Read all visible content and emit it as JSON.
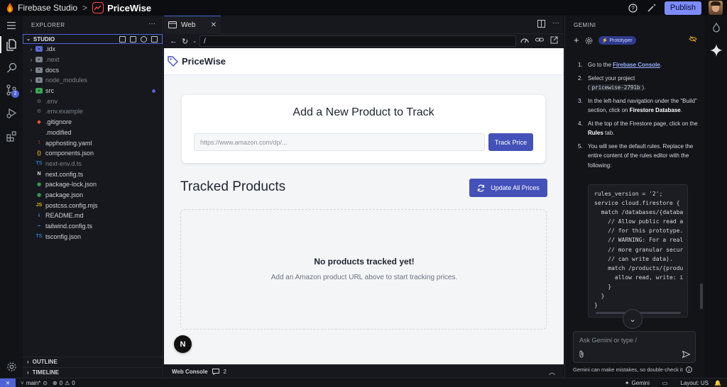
{
  "topbar": {
    "app_name": "Firebase Studio",
    "separator": ">",
    "project_name": "PriceWise",
    "publish_label": "Publish"
  },
  "explorer": {
    "header": "EXPLORER",
    "more": "···",
    "root": "STUDIO",
    "items": [
      {
        "label": ".idx",
        "dim": false,
        "folder": true
      },
      {
        "label": ".next",
        "dim": true,
        "folder": true
      },
      {
        "label": "docs",
        "dim": false,
        "folder": true
      },
      {
        "label": "node_modules",
        "dim": true,
        "folder": true
      },
      {
        "label": "src",
        "dim": false,
        "folder": true,
        "modified": true
      },
      {
        "label": ".env",
        "dim": true,
        "folder": false
      },
      {
        "label": ".env.example",
        "dim": true,
        "folder": false
      },
      {
        "label": ".gitignore",
        "dim": false,
        "folder": false
      },
      {
        "label": ".modified",
        "dim": false,
        "folder": false
      },
      {
        "label": "apphosting.yaml",
        "dim": false,
        "folder": false
      },
      {
        "label": "components.json",
        "dim": false,
        "folder": false
      },
      {
        "label": "next-env.d.ts",
        "dim": true,
        "folder": false
      },
      {
        "label": "next.config.ts",
        "dim": false,
        "folder": false
      },
      {
        "label": "package-lock.json",
        "dim": false,
        "folder": false
      },
      {
        "label": "package.json",
        "dim": false,
        "folder": false
      },
      {
        "label": "postcss.config.mjs",
        "dim": false,
        "folder": false
      },
      {
        "label": "README.md",
        "dim": false,
        "folder": false
      },
      {
        "label": "tailwind.config.ts",
        "dim": false,
        "folder": false
      },
      {
        "label": "tsconfig.json",
        "dim": false,
        "folder": false
      }
    ],
    "outline": "OUTLINE",
    "timeline": "TIMELINE",
    "source_control_badge": "2"
  },
  "web": {
    "tab_label": "Web",
    "url": "/",
    "page": {
      "brand": "PriceWise",
      "card_title": "Add a New Product to Track",
      "url_placeholder": "https://www.amazon.com/dp/...",
      "track_button": "Track Price",
      "section_title": "Tracked Products",
      "update_button": "Update All Prices",
      "empty_title": "No products tracked yet!",
      "empty_sub": "Add an Amazon product URL above to start tracking prices.",
      "next_badge": "N"
    },
    "console_label": "Web Console",
    "console_count": "2"
  },
  "gemini": {
    "header": "GEMINI",
    "prototyper_label": "Prototyper",
    "steps": {
      "s1_pre": "Go to the ",
      "s1_link": "Firebase Console",
      "s1_post": ".",
      "s2_pre": "Select your project",
      "s2_code": "pricewise-2791b",
      "s2_post": ".",
      "s3_pre": "In the left-hand navigation under the \"Build\" section, click on ",
      "s3_bold": "Firestore Database",
      "s3_post": ".",
      "s4_pre": "At the top of the Firestore page, click on the ",
      "s4_bold": "Rules",
      "s4_post": " tab.",
      "s5": "You will see the default rules. Replace the entire content of the rules editor with the following:"
    },
    "code": "rules_version = '2';\nservice cloud.firestore {\n  match /databases/{databa\n    // Allow public read a\n    // for this prototype.\n    // WARNING: For a real\n    // more granular secur\n    // can write data).\n    match /products/{produ\n      allow read, write: i\n    }\n  }\n}",
    "ask_placeholder": "Ask Gemini or type /",
    "disclaimer": "Gemini can make mistakes, so double-check it"
  },
  "statusbar": {
    "branch": "main*",
    "errors": "0",
    "warnings": "0",
    "gemini": "Gemini",
    "layout": "Layout: US"
  },
  "colors": {
    "accent": "#4f62d6",
    "button": "#4451b8",
    "publish": "#7c8cff",
    "firebase_orange": "#ff6d00"
  }
}
